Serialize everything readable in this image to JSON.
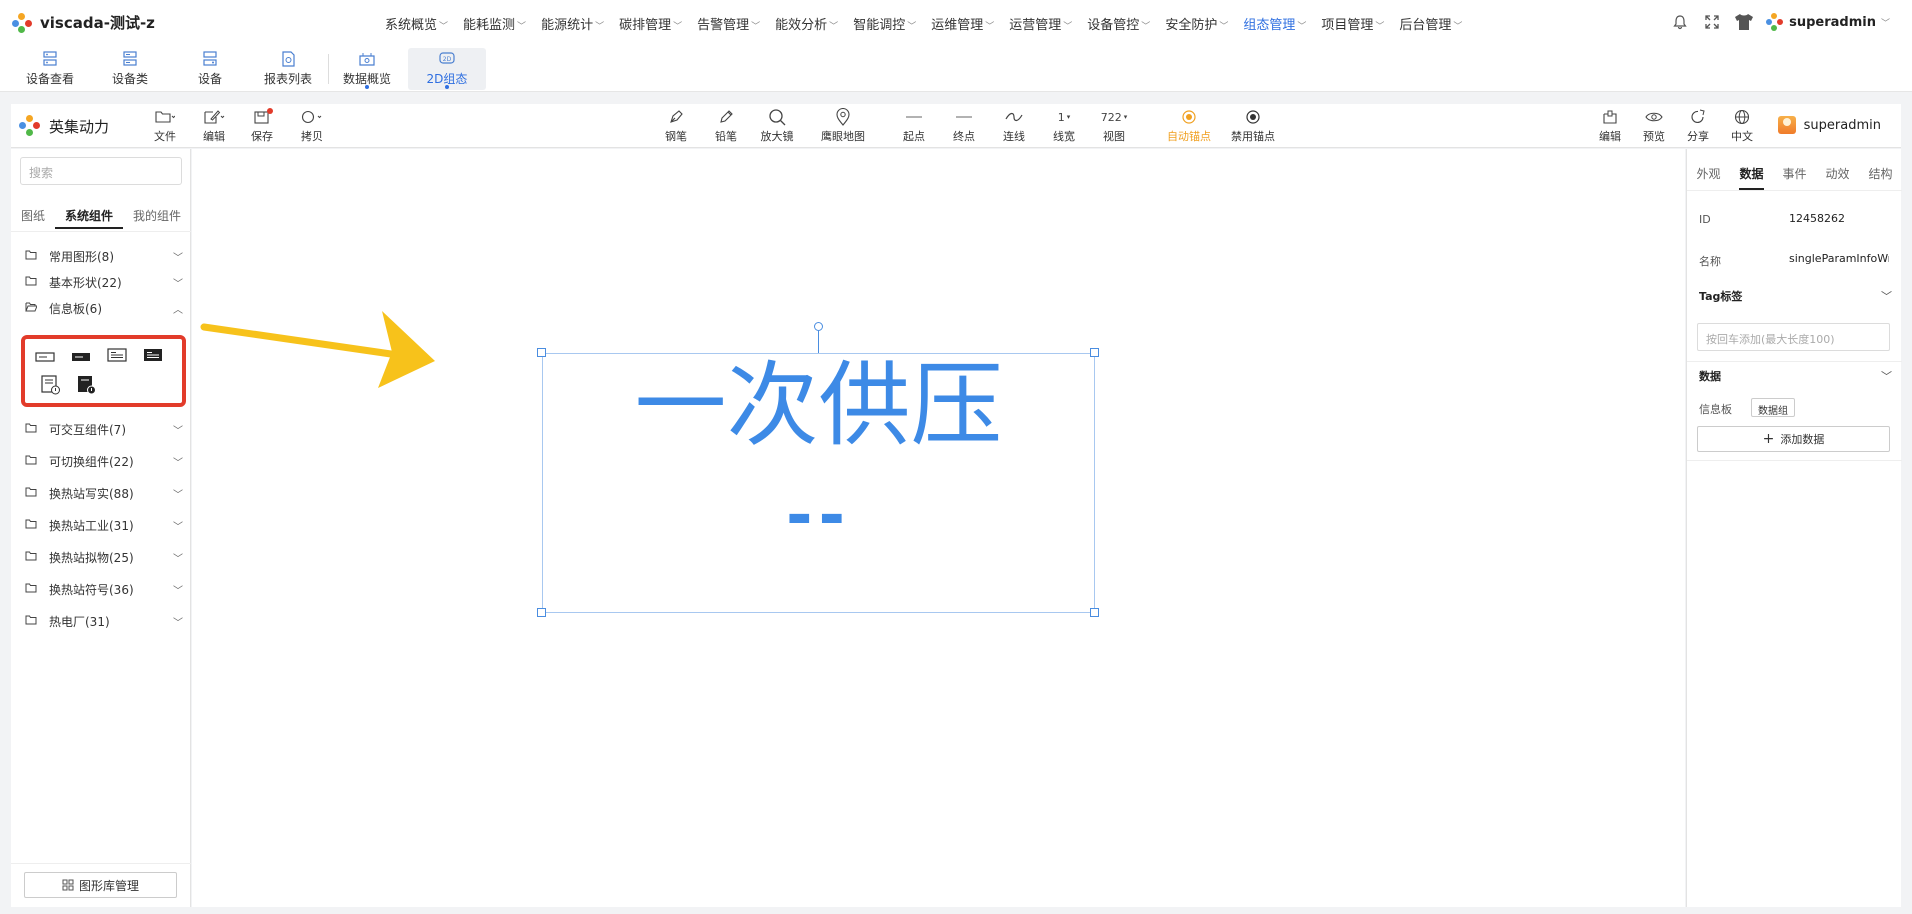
{
  "app": {
    "title": "viscada-测试-z"
  },
  "nav": {
    "items": [
      "系统概览",
      "能耗监测",
      "能源统计",
      "碳排管理",
      "告警管理",
      "能效分析",
      "智能调控",
      "运维管理",
      "运营管理",
      "设备管控",
      "安全防护",
      "组态管理",
      "项目管理",
      "后台管理"
    ],
    "active": "组态管理"
  },
  "user": {
    "name": "superadmin"
  },
  "quickbar": {
    "items": [
      {
        "label": "设备查看",
        "icon": "device-view-icon"
      },
      {
        "label": "设备类",
        "icon": "device-class-icon"
      },
      {
        "label": "设备",
        "icon": "device-icon"
      },
      {
        "label": "报表列表",
        "icon": "report-icon"
      },
      {
        "label": "数据概览",
        "icon": "data-overview-icon"
      },
      {
        "label": "2D组态",
        "icon": "2d-config-icon"
      }
    ]
  },
  "editor": {
    "brand": "英集动力",
    "left_tools": [
      "文件",
      "编辑",
      "保存",
      "拷贝"
    ],
    "center_tools": [
      "钢笔",
      "铅笔",
      "放大镜",
      "鹰眼地图",
      "起点",
      "终点",
      "连线",
      "线宽",
      "视图",
      "自动锚点",
      "禁用锚点"
    ],
    "line_width_value": "1",
    "view_value": "722",
    "right_tools": [
      "编辑",
      "预览",
      "分享",
      "中文"
    ],
    "user": "superadmin"
  },
  "left_panel": {
    "search_placeholder": "搜索",
    "tabs": [
      "图纸",
      "系统组件",
      "我的组件"
    ],
    "active_tab": "系统组件",
    "categories": [
      "常用图形(8)",
      "基本形状(22)",
      "信息板(6)",
      "可交互组件(7)",
      "可切换组件(22)",
      "换热站写实(88)",
      "换热站工业(31)",
      "换热站拟物(25)",
      "换热站符号(36)",
      "热电厂(31)"
    ],
    "expanded_category": "信息板(6)",
    "footer_button": "图形库管理"
  },
  "canvas": {
    "info_board_title": "一次供压",
    "info_board_value": "--",
    "accent_color": "#3d8ae6",
    "arrow_color": "#f7c21b",
    "highlight_color": "#e23b2a"
  },
  "right_panel": {
    "tabs": [
      "外观",
      "数据",
      "事件",
      "动效",
      "结构"
    ],
    "active_tab": "数据",
    "id_label": "ID",
    "id_value": "12458262",
    "name_label": "名称",
    "name_value": "singleParamInfoWr",
    "tag_section": "Tag标签",
    "tag_placeholder": "按回车添加(最大长度100)",
    "data_section": "数据",
    "info_board_label": "信息板",
    "data_group_chip": "数据组",
    "add_data_button": "添加数据"
  }
}
